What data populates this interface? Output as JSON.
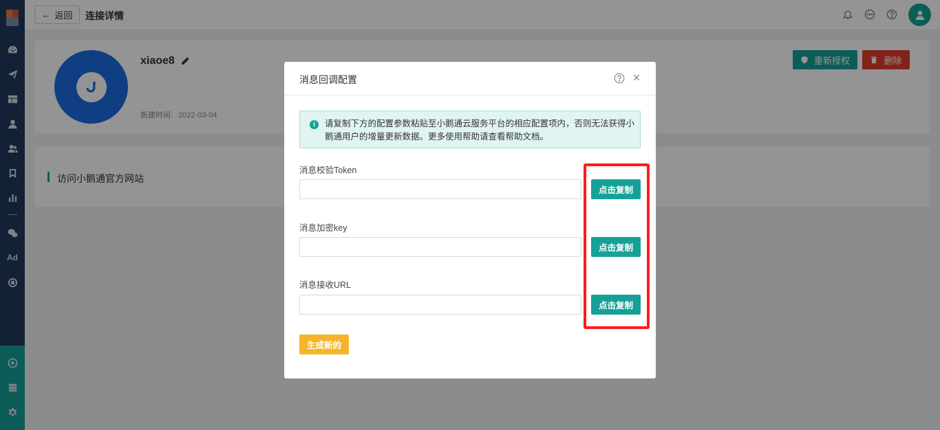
{
  "header": {
    "back_label": "返回",
    "title": "连接详情"
  },
  "profile": {
    "name": "xiaoe8",
    "created_label": "新建时间:",
    "created_value": "2022-03-04",
    "reauth_label": "重新授权",
    "delete_label": "删除"
  },
  "visit": {
    "label": "访问小鹅通官方网站"
  },
  "modal": {
    "title": "消息回调配置",
    "notice": "请复制下方的配置参数粘贴至小鹅通云服务平台的相应配置项内，否则无法获得小鹅通用户的增量更新数据。更多使用帮助请查看帮助文档。",
    "fields": [
      {
        "label": "消息校验Token",
        "value": "",
        "copy_label": "点击复制"
      },
      {
        "label": "消息加密key",
        "value": "",
        "copy_label": "点击复制"
      },
      {
        "label": "消息接收URL",
        "value": "",
        "copy_label": "点击复制"
      }
    ],
    "generate_label": "生成新的"
  },
  "sidebar": {
    "ad_label": "Ad"
  },
  "colors": {
    "accent": "#16a196",
    "sidebar": "#1f3a5c",
    "danger": "#e13b2b",
    "warning": "#f5b52a",
    "highlight": "#ff1a1a"
  }
}
